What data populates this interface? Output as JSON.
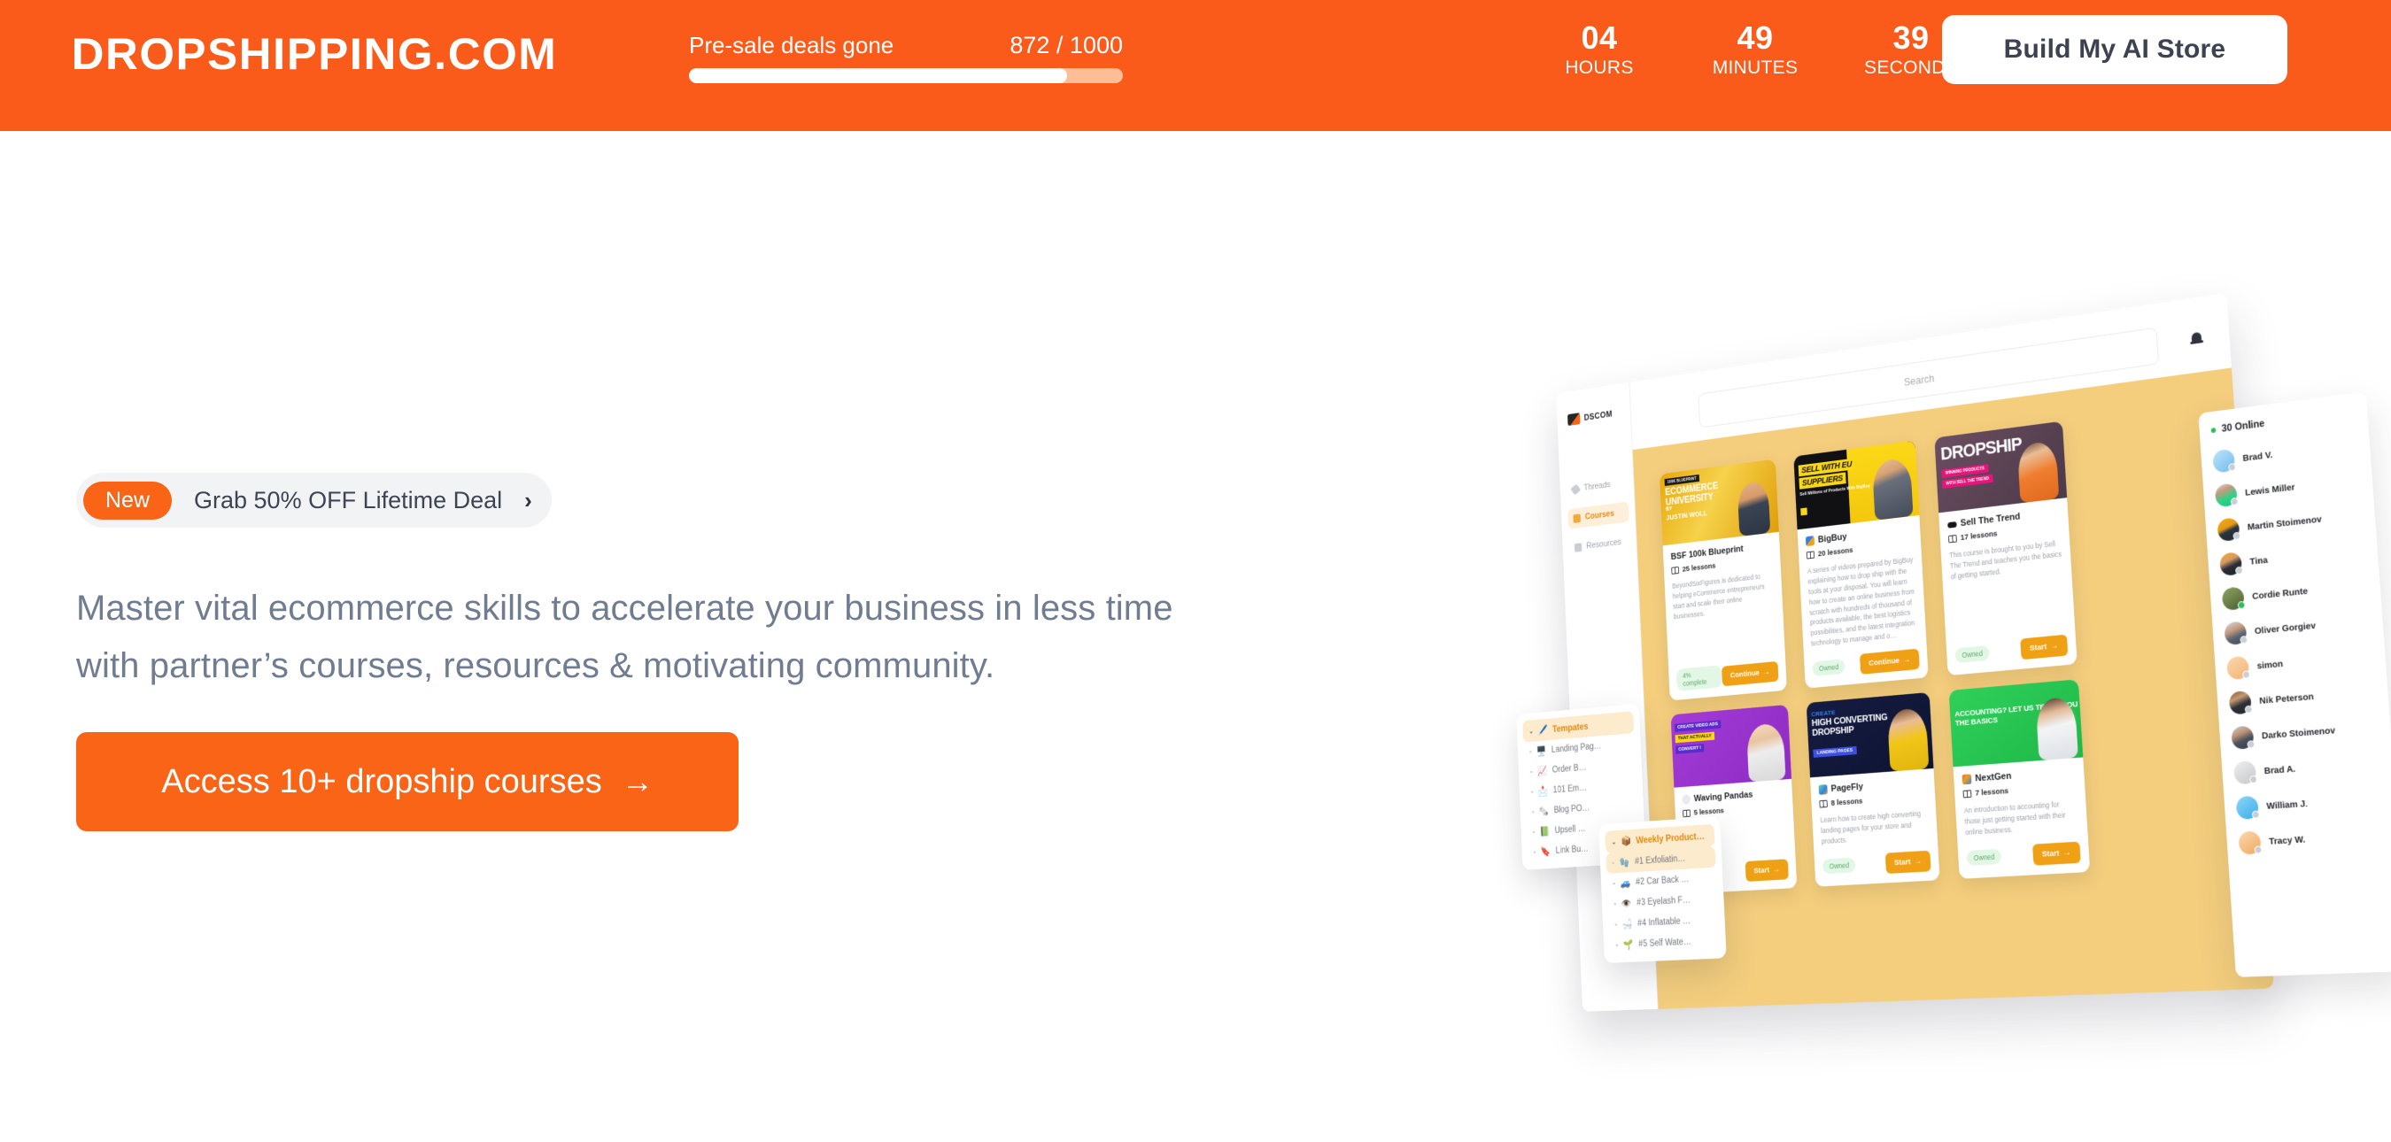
{
  "topbar": {
    "logo": "DROPSHIPPING.COM",
    "presale": {
      "label": "Pre-sale deals gone",
      "count": "872 / 1000",
      "percent": 87.2
    },
    "countdown": [
      {
        "value": "04",
        "unit": "HOURS"
      },
      {
        "value": "49",
        "unit": "MINUTES"
      },
      {
        "value": "39",
        "unit": "SECONDS"
      }
    ],
    "cta_button": "Build My AI Store",
    "bg_color": "#FA5B1B"
  },
  "hero": {
    "promo": {
      "badge": "New",
      "text": "Grab 50% OFF Lifetime Deal",
      "chevron": "›"
    },
    "headline_line1": "Master vital ecommerce skills to accelerate your business in less time",
    "headline_line2": "with partner’s courses, resources & motivating community.",
    "cta": "Access 10+ dropship courses",
    "cta_arrow": "→",
    "accent_color": "#F96417"
  },
  "mockup": {
    "app_name": "DSCOM",
    "search_placeholder": "Search",
    "nav": [
      {
        "label": "Threads",
        "active": false
      },
      {
        "label": "Courses",
        "active": true
      },
      {
        "label": "Resources",
        "active": false
      }
    ],
    "courses": [
      {
        "thumb_tag": "100K BLUEPRINT",
        "thumb_l1": "ECOMMERCE",
        "thumb_l2": "UNIVERSITY",
        "thumb_l3": "BY",
        "thumb_l4": "JUSTIN WOLL",
        "title": "BSF 100k Blueprint",
        "lessons": "25 lessons",
        "desc": "BeyondSixFigures is dedicated to helping eCommerce entrepreneurs start and scale their online businesses.",
        "badge": "4% complete",
        "action": "Continue"
      },
      {
        "thumb_l1": "SELL WITH EU",
        "thumb_l2": "SUPPLIERS",
        "thumb_l3": "Sell Millions of Products With BigBuy",
        "title": "BigBuy",
        "lessons": "20 lessons",
        "desc": "A series of videos prepared by BigBuy explaining how to drop ship with the tools at your disposal. You will learn how to create an online business from scratch with hundreds of thousand of products available, the best logistics possibilities, and the latest integration technology to manage and o…",
        "badge": "Owned",
        "action": "Continue"
      },
      {
        "thumb_l1": "DROPSHIP",
        "thumb_l2": "WINNING PRODUCTS",
        "thumb_l3": "WITH SELL THE TREND",
        "title": "Sell The Trend",
        "lessons": "17 lessons",
        "desc": "This course is brought to you by Sell The Trend and teaches you the basics of getting started.",
        "badge": "Owned",
        "action": "Start"
      },
      {
        "thumb_l1": "CREATE VIDEO ADS",
        "thumb_l2": "THAT ACTUALLY",
        "thumb_l3": "CONVERT !",
        "title": "Waving Pandas",
        "lessons": "5 lessons",
        "desc": "",
        "badge": "",
        "action": "Start"
      },
      {
        "thumb_l0": "CREATE",
        "thumb_l1": "HIGH CONVERTING DROPSHIP",
        "thumb_l2": "LANDING PAGES",
        "title": "PageFly",
        "lessons": "8 lessons",
        "desc": "Learn how to create high converting landing pages for your store and products.",
        "badge": "Owned",
        "action": "Start"
      },
      {
        "thumb_l1": "ACCOUNTING? LET US TEACH YOU THE BASICS",
        "title": "NextGen",
        "lessons": "7 lessons",
        "desc": "An introduction to accounting for those just getting started with their online business.",
        "badge": "Owned",
        "action": "Start"
      }
    ],
    "members_panel": {
      "online_label": "30 Online",
      "members": [
        {
          "name": "Brad V.",
          "online": false,
          "color": "linear-gradient(145deg,#BFE4FA,#6FBCEE)"
        },
        {
          "name": "Lewis Miller",
          "online": false,
          "color": "linear-gradient(160deg,#D9DDE3 0%,#C49A7A 30%,#2ED389 62%,#22C07C 100%)"
        },
        {
          "name": "Martin Stoimenov",
          "online": false,
          "color": "linear-gradient(160deg,#F0A91C 0%,#E49A12 40%,#2B3542 55%,#1E2733 100%)"
        },
        {
          "name": "Tina",
          "online": false,
          "color": "linear-gradient(160deg,#F0A91C 0%,#D79A6A 35%,#2B2F36 58%,#1E2228 100%)"
        },
        {
          "name": "Cordie Runte",
          "online": true,
          "color": "linear-gradient(150deg,#8DA464,#6A7F46 55%,#4A5C33)"
        },
        {
          "name": "Oliver Gorgiev",
          "online": false,
          "color": "linear-gradient(160deg,#D6D9E8 0%,#C49A7A 38%,#5C6474 62%,#454C5A 100%)"
        },
        {
          "name": "simon",
          "online": false,
          "color": "linear-gradient(150deg,#FBD9AE,#F3B374)"
        },
        {
          "name": "Nik Peterson",
          "online": false,
          "color": "linear-gradient(160deg,#7C5A3C 0%,#C99A70 32%,#2E3139 58%,#22252B 100%)"
        },
        {
          "name": "Darko Stoimenov",
          "online": false,
          "color": "linear-gradient(160deg,#C8CCD2 0%,#BD9375 34%,#4B525E 60%,#383E48 100%)"
        },
        {
          "name": "Brad A.",
          "online": false,
          "color": "linear-gradient(150deg,#EFEFEF,#C6C8CB)"
        },
        {
          "name": "William J.",
          "online": false,
          "color": "linear-gradient(145deg,#8ED6F7,#3AAEE8)"
        },
        {
          "name": "Tracy W.",
          "online": false,
          "color": "linear-gradient(150deg,#FBD9AE,#F0A95F)"
        }
      ]
    },
    "templates_panel": {
      "chevron": "⌄",
      "emoji": "🖊️",
      "title": "Tempates",
      "items": [
        {
          "icon": "🖥️",
          "label": "Landing Pag…"
        },
        {
          "icon": "📈",
          "label": "Order B…"
        },
        {
          "icon": "📩",
          "label": "101 Em…"
        },
        {
          "icon": "🗞️",
          "label": "Blog PO…"
        },
        {
          "icon": "📗",
          "label": "Upsell …"
        },
        {
          "icon": "🔖",
          "label": "Link Bu…"
        }
      ]
    },
    "weekly_panel": {
      "chevron": "⌄",
      "emoji": "📦",
      "title": "Weekly Product…",
      "items": [
        {
          "icon": "🧤",
          "label": "#1 Exfoliatin…",
          "highlight": true
        },
        {
          "icon": "🚙",
          "label": "#2 Car Back …",
          "highlight": false
        },
        {
          "icon": "👁️",
          "label": "#3 Eyelash F…",
          "highlight": false
        },
        {
          "icon": "🛁",
          "label": "#4 Inflatable …",
          "highlight": false
        },
        {
          "icon": "🌱",
          "label": "#5 Self Wate…",
          "highlight": false
        }
      ]
    }
  }
}
